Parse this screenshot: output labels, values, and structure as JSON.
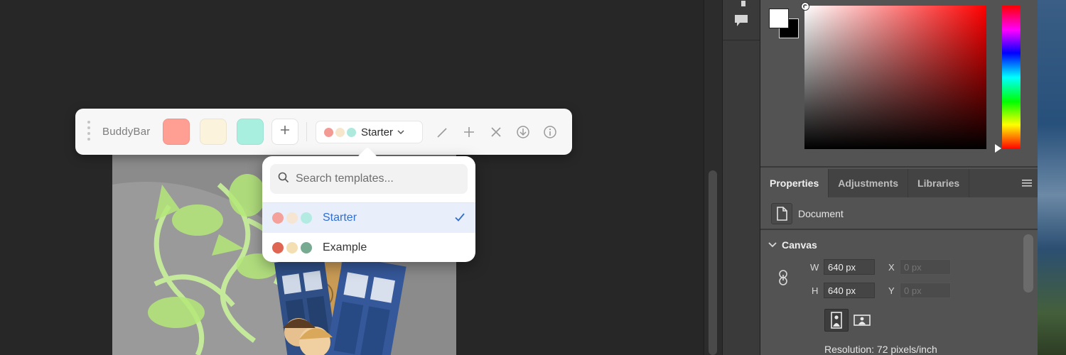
{
  "buddybar": {
    "title": "BuddyBar",
    "swatches": [
      "#ff9e93",
      "#fbf3db",
      "#a9efe0"
    ],
    "template_select": {
      "label": "Starter",
      "dots": [
        "#f29a93",
        "#f6e6cc",
        "#aee9de"
      ]
    }
  },
  "template_dropdown": {
    "search_placeholder": "Search templates...",
    "items": [
      {
        "label": "Starter",
        "selected": true,
        "dots": [
          "#f4a19b",
          "#f5e5d2",
          "#b3ebe2"
        ]
      },
      {
        "label": "Example",
        "selected": false,
        "dots": [
          "#e06654",
          "#f4dfb3",
          "#78aa92"
        ]
      }
    ]
  },
  "properties_panel": {
    "tabs": [
      "Properties",
      "Adjustments",
      "Libraries"
    ],
    "active_tab": "Properties",
    "document_label": "Document",
    "canvas_heading": "Canvas",
    "width_label": "W",
    "width_value": "640 px",
    "height_label": "H",
    "height_value": "640 px",
    "x_label": "X",
    "x_placeholder": "0 px",
    "y_label": "Y",
    "y_placeholder": "0 px",
    "resolution": "Resolution: 72 pixels/inch"
  },
  "color_picker": {
    "foreground": "#ffffff",
    "background": "#000000",
    "hue": "#ff0000"
  }
}
